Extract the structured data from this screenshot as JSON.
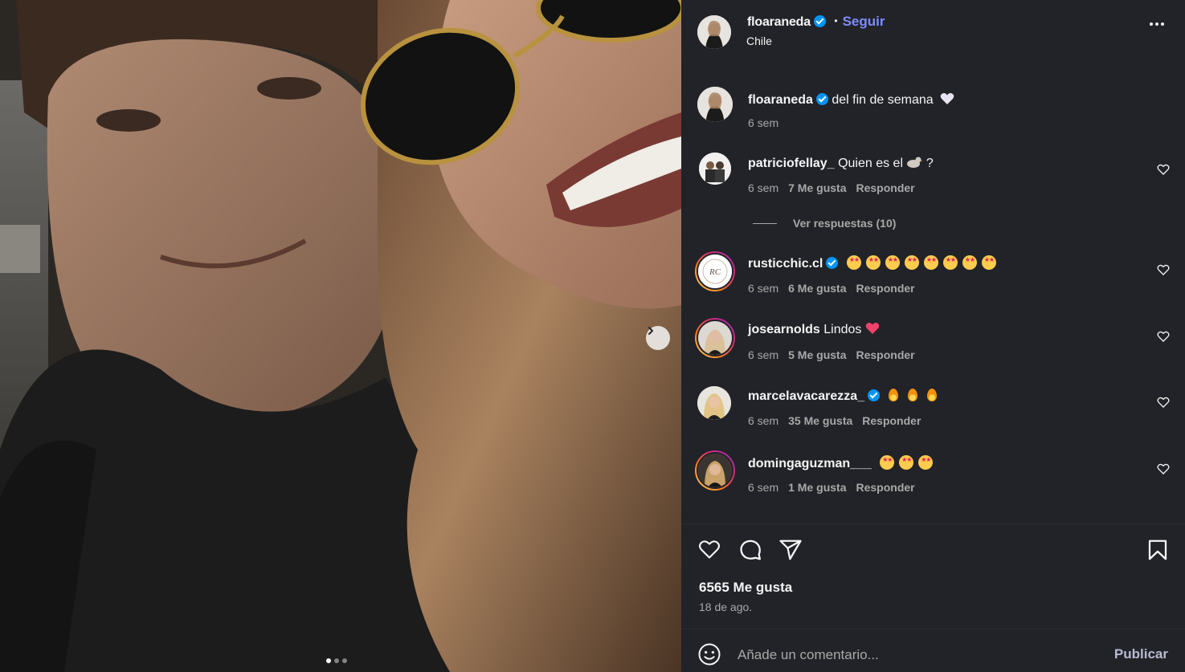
{
  "post": {
    "username": "floaraneda",
    "follow_label": "Seguir",
    "separator": "•",
    "location": "Chile",
    "caption_text": "del fin de semana",
    "caption_time": "6 sem"
  },
  "comments": [
    {
      "user": "patriciofellay_",
      "text": "Quien es el",
      "text_suffix": "?",
      "time": "6 sem",
      "likes": "7 Me gusta",
      "reply": "Responder"
    },
    {
      "user": "rusticchic.cl",
      "text": "",
      "time": "6 sem",
      "likes": "6 Me gusta",
      "reply": "Responder"
    },
    {
      "user": "josearnolds",
      "text": "Lindos",
      "time": "6 sem",
      "likes": "5 Me gusta",
      "reply": "Responder"
    },
    {
      "user": "marcelavacarezza_",
      "text": "",
      "time": "6 sem",
      "likes": "35 Me gusta",
      "reply": "Responder"
    },
    {
      "user": "domingaguzman___",
      "text": "",
      "time": "6 sem",
      "likes": "1 Me gusta",
      "reply": "Responder"
    }
  ],
  "replies_label": "Ver respuestas (10)",
  "likes_count": "6565 Me gusta",
  "date": "18 de ago.",
  "add_comment": {
    "placeholder": "Añade un comentario...",
    "publish_label": "Publicar"
  },
  "carousel": {
    "total": 3,
    "active": 1
  },
  "colors": {
    "panel_bg": "#212328",
    "follow": "#7f8cff",
    "verified": "#0095f6",
    "muted": "#a8a8a8"
  },
  "icons": [
    "heart-icon",
    "comment-icon",
    "share-icon",
    "bookmark-icon",
    "emoji-icon",
    "chevron-right-icon",
    "more-icon",
    "verified-icon"
  ]
}
